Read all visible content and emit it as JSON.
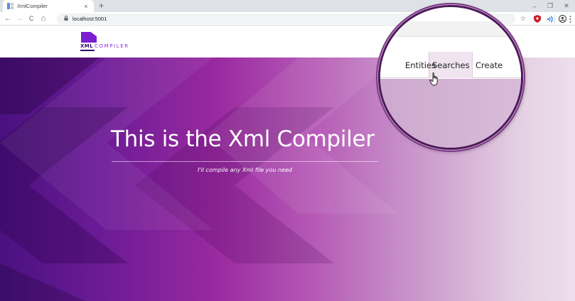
{
  "browser": {
    "tab_title": "XmlCompiler",
    "tab_close": "×",
    "new_tab": "+",
    "url": "localhost:5001",
    "window_controls": {
      "minimize": "–",
      "restore": "❐",
      "close": "✕"
    },
    "nav": {
      "back": "←",
      "forward": "→",
      "reload": "C",
      "home": "⌂"
    },
    "toolbar_icons": [
      "star-icon",
      "shield-extension-icon",
      "audio-extension-icon",
      "profile-icon",
      "menu-icon"
    ]
  },
  "site": {
    "logo": {
      "word1": "XML",
      "word2": "COMPILER"
    },
    "nav": {
      "entities": "Entities",
      "searches": "Searches",
      "create": "Create"
    }
  },
  "hero": {
    "title": "This is the Xml Compiler",
    "subtitle": "I'll compile any Xml file you need"
  },
  "colors": {
    "brand_purple": "#7a1fd0",
    "hero_start": "#4a117f",
    "hero_mid": "#9a2aa0",
    "hero_end": "#eddfec",
    "magnifier_border": "#4b1a57"
  }
}
